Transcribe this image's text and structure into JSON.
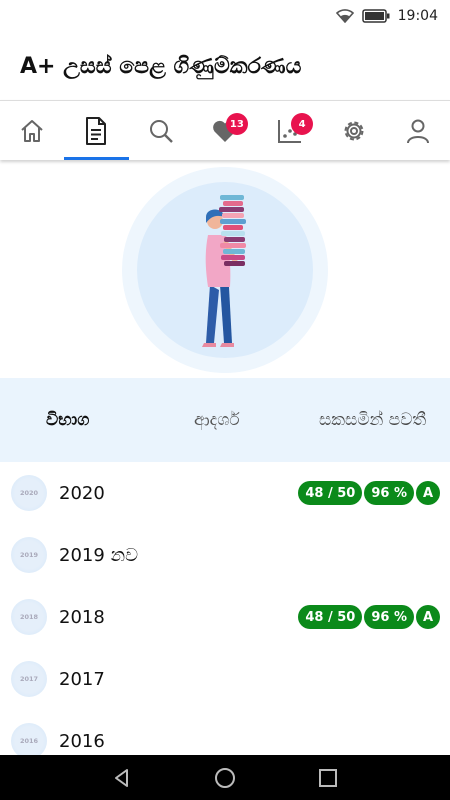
{
  "status_bar": {
    "time": "19:04"
  },
  "app": {
    "title": "A+ උසස් පෙළ ගිණුම්කරණය"
  },
  "tabs": [
    {
      "name": "home",
      "icon": "home-icon",
      "badge": ""
    },
    {
      "name": "papers",
      "icon": "document-icon",
      "badge": "",
      "active": true
    },
    {
      "name": "search",
      "icon": "search-icon",
      "badge": ""
    },
    {
      "name": "favorites",
      "icon": "heart-icon",
      "badge": "13"
    },
    {
      "name": "stats",
      "icon": "scatter-chart-icon",
      "badge": "4"
    },
    {
      "name": "settings",
      "icon": "gear-icon",
      "badge": ""
    },
    {
      "name": "profile",
      "icon": "person-icon",
      "badge": ""
    }
  ],
  "table_header": {
    "col1": "විභාග",
    "col2": "ආදර්ශ",
    "col3": "සකසමින් පවතී"
  },
  "rows": [
    {
      "icon_text": "2020",
      "label": "2020",
      "score": "48 / 50",
      "percent": "96 %",
      "grade": "A"
    },
    {
      "icon_text": "2019",
      "label": "2019 නව",
      "score": "",
      "percent": "",
      "grade": ""
    },
    {
      "icon_text": "2018",
      "label": "2018",
      "score": "48 / 50",
      "percent": "96 %",
      "grade": "A"
    },
    {
      "icon_text": "2017",
      "label": "2017",
      "score": "",
      "percent": "",
      "grade": ""
    },
    {
      "icon_text": "2016",
      "label": "2016",
      "score": "",
      "percent": "",
      "grade": ""
    }
  ],
  "colors": {
    "accent": "#1a73e8",
    "badge": "#e8134e",
    "pill": "#0b8a1a",
    "header_bg": "#eaf4fd"
  }
}
